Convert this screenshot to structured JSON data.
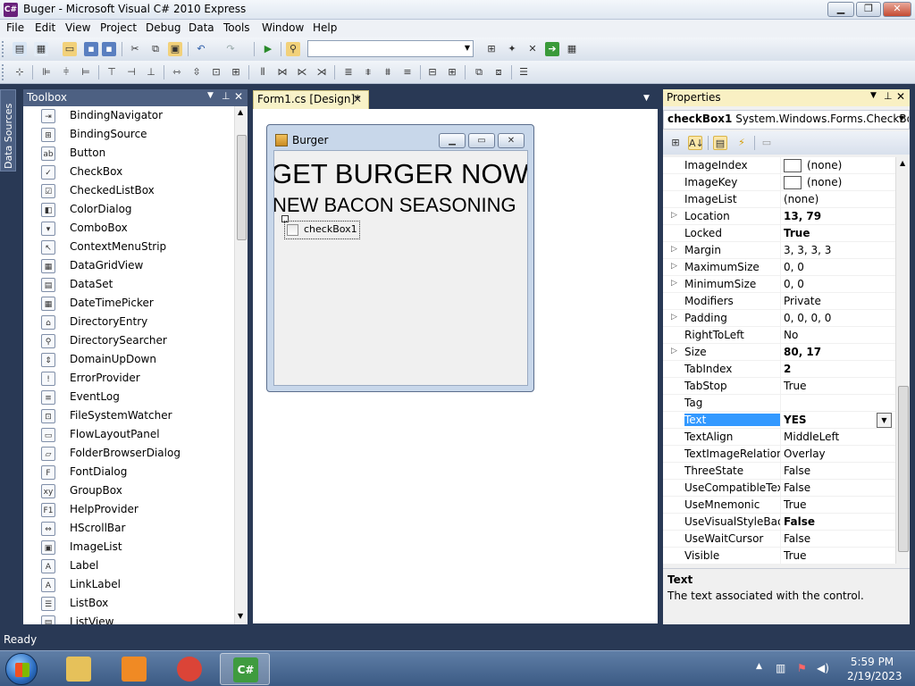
{
  "window": {
    "title": "Buger - Microsoft Visual C# 2010 Express",
    "app_icon": "C#"
  },
  "menu": [
    "File",
    "Edit",
    "View",
    "Project",
    "Debug",
    "Data",
    "Tools",
    "Window",
    "Help"
  ],
  "toolbar": {
    "config_dropdown_value": ""
  },
  "side_tabs": {
    "data_sources": "Data Sources"
  },
  "toolbox": {
    "title": "Toolbox",
    "items": [
      {
        "label": "BindingNavigator",
        "icon": "binding-navigator-icon",
        "glyph": "⇥"
      },
      {
        "label": "BindingSource",
        "icon": "binding-source-icon",
        "glyph": "⊞"
      },
      {
        "label": "Button",
        "icon": "button-icon",
        "glyph": "ab"
      },
      {
        "label": "CheckBox",
        "icon": "checkbox-icon",
        "glyph": "✓"
      },
      {
        "label": "CheckedListBox",
        "icon": "checked-listbox-icon",
        "glyph": "☑"
      },
      {
        "label": "ColorDialog",
        "icon": "color-dialog-icon",
        "glyph": "◧"
      },
      {
        "label": "ComboBox",
        "icon": "combobox-icon",
        "glyph": "▾"
      },
      {
        "label": "ContextMenuStrip",
        "icon": "context-menu-icon",
        "glyph": "↖"
      },
      {
        "label": "DataGridView",
        "icon": "datagridview-icon",
        "glyph": "▦"
      },
      {
        "label": "DataSet",
        "icon": "dataset-icon",
        "glyph": "▤"
      },
      {
        "label": "DateTimePicker",
        "icon": "datetime-picker-icon",
        "glyph": "▦"
      },
      {
        "label": "DirectoryEntry",
        "icon": "directory-entry-icon",
        "glyph": "⌂"
      },
      {
        "label": "DirectorySearcher",
        "icon": "directory-searcher-icon",
        "glyph": "⚲"
      },
      {
        "label": "DomainUpDown",
        "icon": "domain-updown-icon",
        "glyph": "⇕"
      },
      {
        "label": "ErrorProvider",
        "icon": "error-provider-icon",
        "glyph": "!"
      },
      {
        "label": "EventLog",
        "icon": "eventlog-icon",
        "glyph": "≡"
      },
      {
        "label": "FileSystemWatcher",
        "icon": "filesystem-watcher-icon",
        "glyph": "⊡"
      },
      {
        "label": "FlowLayoutPanel",
        "icon": "flowlayout-icon",
        "glyph": "▭"
      },
      {
        "label": "FolderBrowserDialog",
        "icon": "folder-browser-icon",
        "glyph": "▱"
      },
      {
        "label": "FontDialog",
        "icon": "font-dialog-icon",
        "glyph": "F"
      },
      {
        "label": "GroupBox",
        "icon": "groupbox-icon",
        "glyph": "xy"
      },
      {
        "label": "HelpProvider",
        "icon": "help-provider-icon",
        "glyph": "F1"
      },
      {
        "label": "HScrollBar",
        "icon": "hscrollbar-icon",
        "glyph": "⇔"
      },
      {
        "label": "ImageList",
        "icon": "imagelist-icon",
        "glyph": "▣"
      },
      {
        "label": "Label",
        "icon": "label-icon",
        "glyph": "A"
      },
      {
        "label": "LinkLabel",
        "icon": "linklabel-icon",
        "glyph": "A"
      },
      {
        "label": "ListBox",
        "icon": "listbox-icon",
        "glyph": "☰"
      },
      {
        "label": "ListView",
        "icon": "listview-icon",
        "glyph": "▤"
      }
    ]
  },
  "designer": {
    "tab_label": "Form1.cs [Design]*",
    "form": {
      "title": "Burger",
      "headline1": "GET BURGER NOW",
      "headline2": "NEW BACON SEASONING",
      "checkbox_label": "checkBox1"
    }
  },
  "properties": {
    "title": "Properties",
    "object_name": "checkBox1",
    "object_type": "System.Windows.Forms.CheckBox",
    "rows": [
      {
        "name": "ImageIndex",
        "value": "(none)",
        "expandable": false,
        "bold": false,
        "swatch": true
      },
      {
        "name": "ImageKey",
        "value": "(none)",
        "expandable": false,
        "bold": false,
        "swatch": true
      },
      {
        "name": "ImageList",
        "value": "(none)",
        "expandable": false,
        "bold": false,
        "swatch": false
      },
      {
        "name": "Location",
        "value": "13, 79",
        "expandable": true,
        "bold": true,
        "swatch": false
      },
      {
        "name": "Locked",
        "value": "True",
        "expandable": false,
        "bold": true,
        "swatch": false
      },
      {
        "name": "Margin",
        "value": "3, 3, 3, 3",
        "expandable": true,
        "bold": false,
        "swatch": false
      },
      {
        "name": "MaximumSize",
        "value": "0, 0",
        "expandable": true,
        "bold": false,
        "swatch": false
      },
      {
        "name": "MinimumSize",
        "value": "0, 0",
        "expandable": true,
        "bold": false,
        "swatch": false
      },
      {
        "name": "Modifiers",
        "value": "Private",
        "expandable": false,
        "bold": false,
        "swatch": false
      },
      {
        "name": "Padding",
        "value": "0, 0, 0, 0",
        "expandable": true,
        "bold": false,
        "swatch": false
      },
      {
        "name": "RightToLeft",
        "value": "No",
        "expandable": false,
        "bold": false,
        "swatch": false
      },
      {
        "name": "Size",
        "value": "80, 17",
        "expandable": true,
        "bold": true,
        "swatch": false
      },
      {
        "name": "TabIndex",
        "value": "2",
        "expandable": false,
        "bold": true,
        "swatch": false
      },
      {
        "name": "TabStop",
        "value": "True",
        "expandable": false,
        "bold": false,
        "swatch": false
      },
      {
        "name": "Tag",
        "value": "",
        "expandable": false,
        "bold": false,
        "swatch": false
      },
      {
        "name": "Text",
        "value": "YES",
        "expandable": false,
        "bold": true,
        "swatch": false,
        "selected": true
      },
      {
        "name": "TextAlign",
        "value": "MiddleLeft",
        "expandable": false,
        "bold": false,
        "swatch": false
      },
      {
        "name": "TextImageRelation",
        "value": "Overlay",
        "expandable": false,
        "bold": false,
        "swatch": false
      },
      {
        "name": "ThreeState",
        "value": "False",
        "expandable": false,
        "bold": false,
        "swatch": false
      },
      {
        "name": "UseCompatibleTextR",
        "value": "False",
        "expandable": false,
        "bold": false,
        "swatch": false
      },
      {
        "name": "UseMnemonic",
        "value": "True",
        "expandable": false,
        "bold": false,
        "swatch": false
      },
      {
        "name": "UseVisualStyleBackC",
        "value": "False",
        "expandable": false,
        "bold": true,
        "swatch": false
      },
      {
        "name": "UseWaitCursor",
        "value": "False",
        "expandable": false,
        "bold": false,
        "swatch": false
      },
      {
        "name": "Visible",
        "value": "True",
        "expandable": false,
        "bold": false,
        "swatch": false
      }
    ],
    "description": {
      "title": "Text",
      "text": "The text associated with the control."
    }
  },
  "status": {
    "text": "Ready"
  },
  "taskbar": {
    "apps": [
      {
        "name": "explorer",
        "color": "#e6c15a",
        "active": false
      },
      {
        "name": "media-player",
        "color": "#f08a24",
        "active": false
      },
      {
        "name": "chrome",
        "color": "#db4437",
        "active": false
      },
      {
        "name": "visual-csharp",
        "color": "#3f9b3f",
        "active": true,
        "label": "C#"
      }
    ],
    "clock_time": "5:59 PM",
    "clock_date": "2/19/2023"
  },
  "colors": {
    "ide_background": "#293955",
    "selected_property": "#3399ff",
    "panel_header": "#4d6082",
    "active_tab": "#f8f2c8"
  }
}
